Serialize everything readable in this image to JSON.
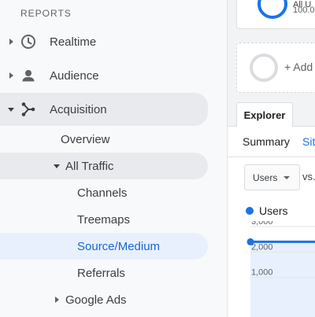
{
  "sidebar": {
    "section_title": "REPORTS",
    "items": [
      {
        "label": "Realtime",
        "icon": "clock-icon"
      },
      {
        "label": "Audience",
        "icon": "person-icon"
      },
      {
        "label": "Acquisition",
        "icon": "acquisition-icon"
      }
    ],
    "acquisition_children": {
      "overview": "Overview",
      "all_traffic": "All Traffic",
      "all_traffic_children": [
        "Channels",
        "Treemaps",
        "Source/Medium",
        "Referrals"
      ],
      "google_ads": "Google Ads"
    },
    "selected": "Source/Medium"
  },
  "main": {
    "card1": {
      "line1": "All U",
      "line2": "100.0"
    },
    "card2": {
      "add_label": "+ Add"
    },
    "explorer_tab": "Explorer",
    "subtabs": {
      "summary": "Summary",
      "site": "Site"
    },
    "metric_dropdown": "Users",
    "vs_label": "vs.",
    "legend": "Users"
  },
  "colors": {
    "accent": "#1a73e8",
    "selected_bg": "#e8f0fe"
  },
  "chart_data": {
    "type": "area",
    "series": [
      {
        "name": "Users",
        "values": [
          2400,
          2400
        ]
      }
    ],
    "y_ticks": [
      "3,000",
      "2,000",
      "1,000"
    ],
    "ylim": [
      0,
      3000
    ]
  }
}
